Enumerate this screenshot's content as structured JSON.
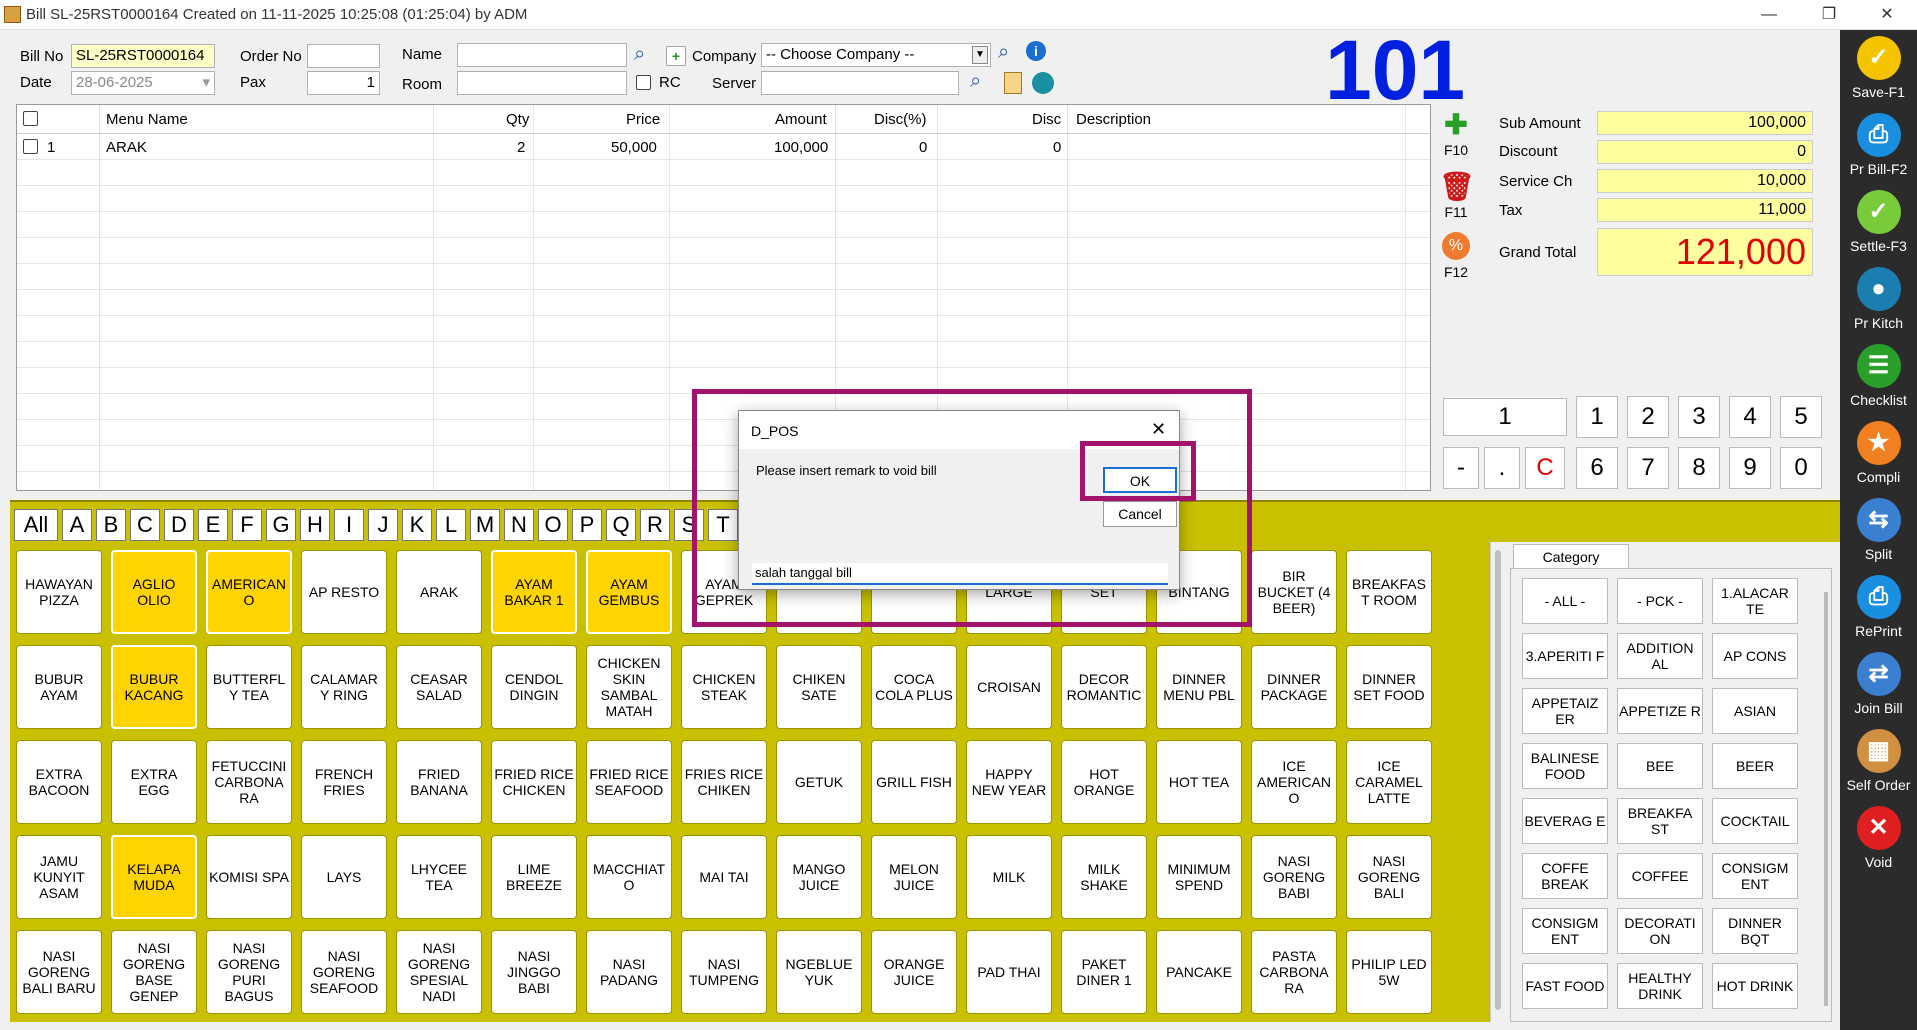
{
  "window": {
    "title": "Bill SL-25RST0000164 Created on 11-11-2025 10:25:08 (01:25:04) by ADM",
    "minimize": "—",
    "restore": "❐",
    "close": "✕"
  },
  "header": {
    "bill_no_label": "Bill No",
    "bill_no": "SL-25RST0000164",
    "date_label": "Date",
    "date": "28-06-2025",
    "order_no_label": "Order No",
    "order_no": "",
    "pax_label": "Pax",
    "pax": "1",
    "name_label": "Name",
    "name": "",
    "room_label": "Room",
    "room": "",
    "rc_label": "RC",
    "company_label": "Company",
    "company": "-- Choose Company --",
    "server_label": "Server",
    "server": ""
  },
  "table_number": "101",
  "grid": {
    "columns": [
      "Menu Name",
      "Qty",
      "Price",
      "Amount",
      "Disc(%)",
      "Disc",
      "Description"
    ],
    "rows": [
      {
        "no": "1",
        "menu": "ARAK",
        "qty": "2",
        "price": "50,000",
        "amount": "100,000",
        "disc_pct": "0",
        "disc": "0",
        "desc": ""
      }
    ]
  },
  "side_buttons": {
    "add": "F10",
    "delete": "F11",
    "discount": "F12"
  },
  "totals": {
    "sub_amount_label": "Sub Amount",
    "sub_amount": "100,000",
    "discount_label": "Discount",
    "discount": "0",
    "service_label": "Service Ch",
    "service": "10,000",
    "tax_label": "Tax",
    "tax": "11,000",
    "grand_total_label": "Grand Total",
    "grand_total": "121,000"
  },
  "numpad": {
    "display": "1",
    "row1": [
      "1",
      "2",
      "3",
      "4",
      "5"
    ],
    "row2": [
      "-",
      ".",
      "C",
      "6",
      "7",
      "8",
      "9",
      "0"
    ]
  },
  "alpha": [
    "All",
    "A",
    "B",
    "C",
    "D",
    "E",
    "F",
    "G",
    "H",
    "I",
    "J",
    "K",
    "L",
    "M",
    "N",
    "O",
    "P",
    "Q",
    "R",
    "S",
    "T"
  ],
  "menu_items": [
    [
      "HAWAYAN PIZZA",
      "AGLIO OLIO",
      "AMERICAN O",
      "AP RESTO",
      "ARAK",
      "AYAM BAKAR 1",
      "AYAM GEMBUS",
      "AYAM GEPREK",
      "",
      "",
      "LARGE",
      "SET",
      "BINTANG",
      "BIR BUCKET (4 BEER)",
      "BREAKFAS T ROOM"
    ],
    [
      "BUBUR AYAM",
      "BUBUR KACANG",
      "BUTTERFL Y TEA",
      "CALAMAR Y RING",
      "CEASAR SALAD",
      "CENDOL DINGIN",
      "CHICKEN SKIN SAMBAL MATAH",
      "CHICKEN STEAK",
      "CHIKEN SATE",
      "COCA COLA PLUS",
      "CROISAN",
      "DECOR ROMANTIC",
      "DINNER MENU PBL",
      "DINNER PACKAGE",
      "DINNER SET FOOD"
    ],
    [
      "EXTRA BACOON",
      "EXTRA EGG",
      "FETUCCINI CARBONA RA",
      "FRENCH FRIES",
      "FRIED BANANA",
      "FRIED RICE CHICKEN",
      "FRIED RICE SEAFOOD",
      "FRIES RICE CHIKEN",
      "GETUK",
      "GRILL FISH",
      "HAPPY NEW YEAR",
      "HOT ORANGE",
      "HOT TEA",
      "ICE AMERICAN O",
      "ICE CARAMEL LATTE"
    ],
    [
      "JAMU KUNYIT ASAM",
      "KELAPA MUDA",
      "KOMISI SPA",
      "LAYS",
      "LHYCEE TEA",
      "LIME BREEZE",
      "MACCHIAT O",
      "MAI TAI",
      "MANGO JUICE",
      "MELON JUICE",
      "MILK",
      "MILK SHAKE",
      "MINIMUM SPEND",
      "NASI GORENG BABI",
      "NASI GORENG BALI"
    ],
    [
      "NASI GORENG BALI BARU",
      "NASI GORENG BASE GENEP",
      "NASI GORENG PURI BAGUS",
      "NASI GORENG SEAFOOD",
      "NASI GORENG SPESIAL NADI",
      "NASI JINGGO BABI",
      "NASI PADANG",
      "NASI TUMPENG",
      "NGEBLUE YUK",
      "ORANGE JUICE",
      "PAD THAI",
      "PAKET DINER 1",
      "PANCAKE",
      "PASTA CARBONA RA",
      "PHILIP LED 5W"
    ]
  ],
  "category": {
    "title": "Category",
    "items": [
      "- ALL -",
      "- PCK -",
      "1.ALACAR TE",
      "3.APERITI F",
      "ADDITION AL",
      "AP CONS",
      "APPETAIZ ER",
      "APPETIZE R",
      "ASIAN",
      "BALINESE FOOD",
      "BEE",
      "BEER",
      "BEVERAG E",
      "BREAKFA ST",
      "COCKTAIL",
      "COFFE BREAK",
      "COFFEE",
      "CONSIGM ENT",
      "CONSIGM ENT",
      "DECORATI ON",
      "DINNER BQT",
      "FAST FOOD",
      "HEALTHY DRINK",
      "HOT DRINK"
    ]
  },
  "right_bar": [
    "Save-F1",
    "Pr Bill-F2",
    "Settle-F3",
    "Pr Kitch",
    "Checklist",
    "Compli",
    "Split",
    "RePrint",
    "Join Bill",
    "Self Order",
    "Void"
  ],
  "dialog": {
    "title": "D_POS",
    "close": "✕",
    "message": "Please insert remark to void bill",
    "ok": "OK",
    "cancel": "Cancel",
    "remark": "salah tanggal bill"
  },
  "colors": {
    "accent_yellow": "#c8c000",
    "selected_item": "#ffd400",
    "grand_total": "#e00000",
    "table_number": "#0020e0",
    "highlight": "#a3136a"
  }
}
